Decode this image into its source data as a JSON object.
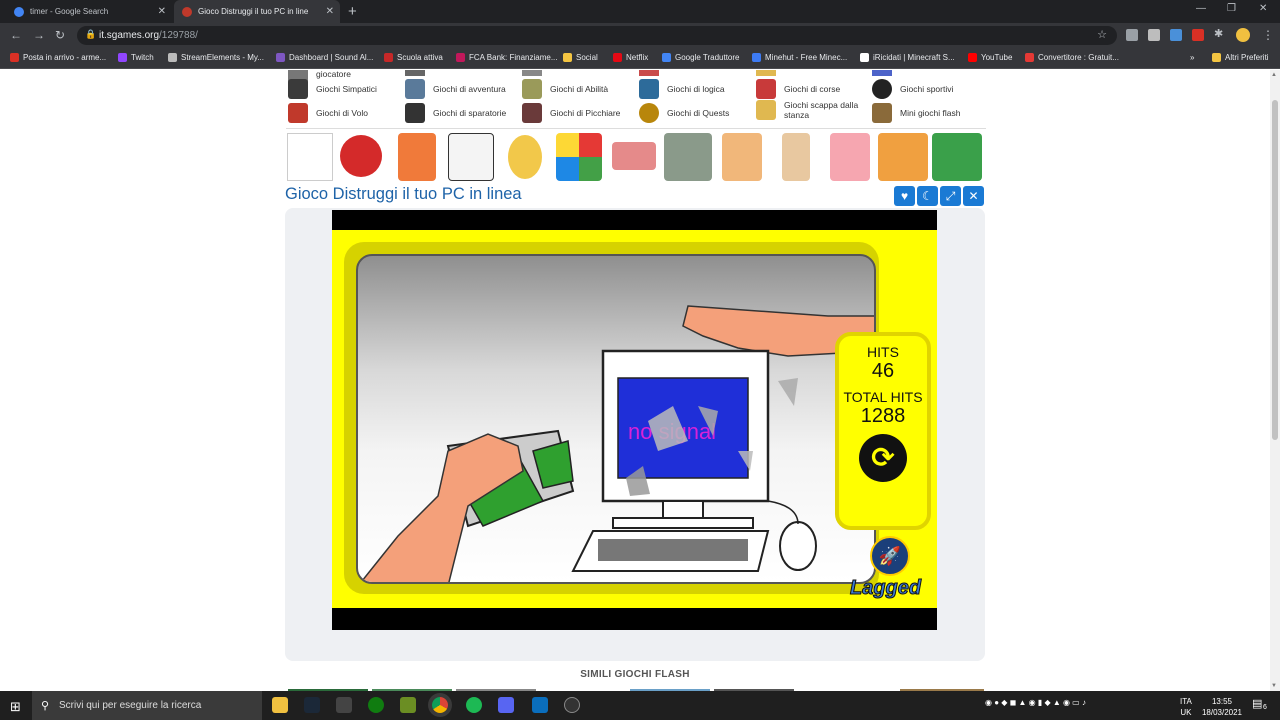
{
  "browser": {
    "tabs": [
      {
        "title": "timer - Google Search",
        "favicon_color": "#4285f4"
      },
      {
        "title": "Gioco Distruggi il tuo PC in line",
        "favicon_color": "#c0392b"
      }
    ],
    "new_tab": "+",
    "window_controls": {
      "minimize": "—",
      "maximize": "❐",
      "close": "✕"
    },
    "url_host": "it.sgames.org",
    "url_path": "/129788/",
    "bookmarks": [
      {
        "label": "Posta in arrivo - arme...",
        "color": "#d93025"
      },
      {
        "label": "Twitch",
        "color": "#9146ff"
      },
      {
        "label": "StreamElements - My...",
        "color": "#bbbbbb"
      },
      {
        "label": "Dashboard | Sound Al...",
        "color": "#7e57c2"
      },
      {
        "label": "Scuola attiva",
        "color": "#c62828"
      },
      {
        "label": "FCA Bank: Finanziame...",
        "color": "#c2185b"
      },
      {
        "label": "Social",
        "color": "#f4c542"
      },
      {
        "label": "Netflix",
        "color": "#e50914"
      },
      {
        "label": "Google Traduttore",
        "color": "#4285f4"
      },
      {
        "label": "Minehut - Free Minec...",
        "color": "#3d7bf4"
      },
      {
        "label": "iRicidati | Minecraft S...",
        "color": "#ffffff"
      },
      {
        "label": "YouTube",
        "color": "#ff0000"
      },
      {
        "label": "Convertitore : Gratuit...",
        "color": "#e53935"
      }
    ],
    "bookmarks_more": "»",
    "other_bookmarks": "Altri Preferiti"
  },
  "categories": [
    {
      "label": "giocatore"
    },
    {
      "label": "Giochi Simpatici"
    },
    {
      "label": "Giochi di avventura"
    },
    {
      "label": "Giochi di Abilità"
    },
    {
      "label": "Giochi di logica"
    },
    {
      "label": "Giochi di corse"
    },
    {
      "label": "Giochi sportivi"
    },
    {
      "label": "Giochi di Volo"
    },
    {
      "label": "Giochi di sparatorie"
    },
    {
      "label": "Giochi di Picchiare"
    },
    {
      "label": "Giochi di Quests"
    },
    {
      "label": "Giochi scappa dalla stanza"
    },
    {
      "label": "Mini giochi flash"
    }
  ],
  "game": {
    "title": "Gioco Distruggi il tuo PC in linea",
    "buttons": {
      "favorite": "♥",
      "night": "☾",
      "fullscreen": "⤢",
      "close": "✕"
    },
    "screen_text": "no signal",
    "hits_label": "HITS",
    "hits_value": "46",
    "total_hits_label": "TOTAL HITS",
    "total_hits_value": "1288",
    "restart_icon": "⟳",
    "brand": "Lagged"
  },
  "similar_title": "SIMILI GIOCHI FLASH",
  "taskbar": {
    "search_placeholder": "Scrivi qui per eseguire la ricerca",
    "lang_top": "ITA",
    "lang_bottom": "UK",
    "time": "13:55",
    "date": "18/03/2021",
    "notifications": "6"
  }
}
